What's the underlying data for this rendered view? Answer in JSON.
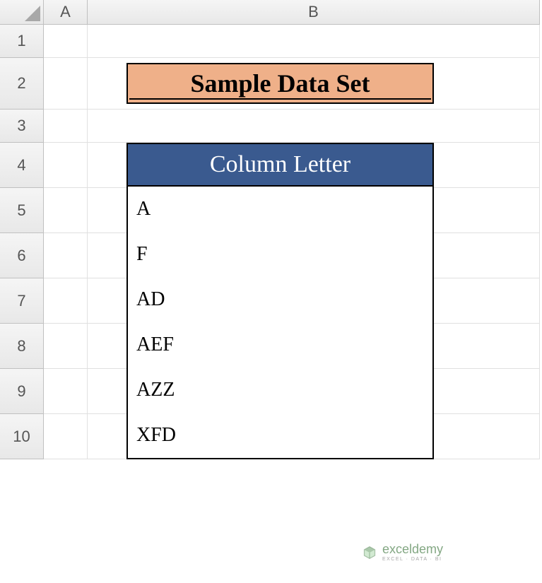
{
  "columns": {
    "A": "A",
    "B": "B"
  },
  "rows": {
    "1": "1",
    "2": "2",
    "3": "3",
    "4": "4",
    "5": "5",
    "6": "6",
    "7": "7",
    "8": "8",
    "9": "9",
    "10": "10"
  },
  "title": "Sample Data Set",
  "tableHeader": "Column Letter",
  "data": {
    "row5": "A",
    "row6": "F",
    "row7": "AD",
    "row8": "AEF",
    "row9": "AZZ",
    "row10": "XFD"
  },
  "watermark": {
    "main": "exceldemy",
    "sub": "EXCEL · DATA · BI"
  }
}
